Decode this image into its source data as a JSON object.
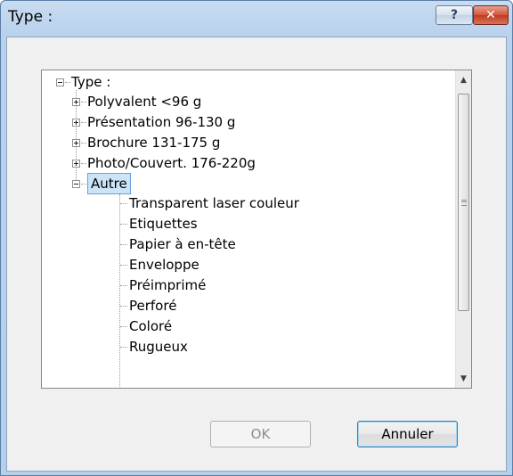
{
  "window": {
    "title": "Type :",
    "help_label": "?",
    "close_label": "✕"
  },
  "tree": {
    "root_label": "Type :",
    "items": [
      {
        "label": "Polyvalent <96 g",
        "expanded": false
      },
      {
        "label": "Présentation 96-130 g",
        "expanded": false
      },
      {
        "label": "Brochure 131-175 g",
        "expanded": false
      },
      {
        "label": "Photo/Couvert. 176-220g",
        "expanded": false
      },
      {
        "label": "Autre",
        "expanded": true,
        "selected": true
      }
    ],
    "children": [
      "Transparent laser couleur",
      "Etiquettes",
      "Papier à en-tête",
      "Enveloppe",
      "Préimprimé",
      "Perforé",
      "Coloré",
      "Rugueux"
    ]
  },
  "scrollbar": {
    "up_arrow": "▲",
    "down_arrow": "▼"
  },
  "buttons": {
    "ok_label": "OK",
    "cancel_label": "Annuler"
  },
  "colors": {
    "selection_border": "#6da0d6",
    "selection_fill": "#cce4f7",
    "close_button": "#c13a1f"
  }
}
